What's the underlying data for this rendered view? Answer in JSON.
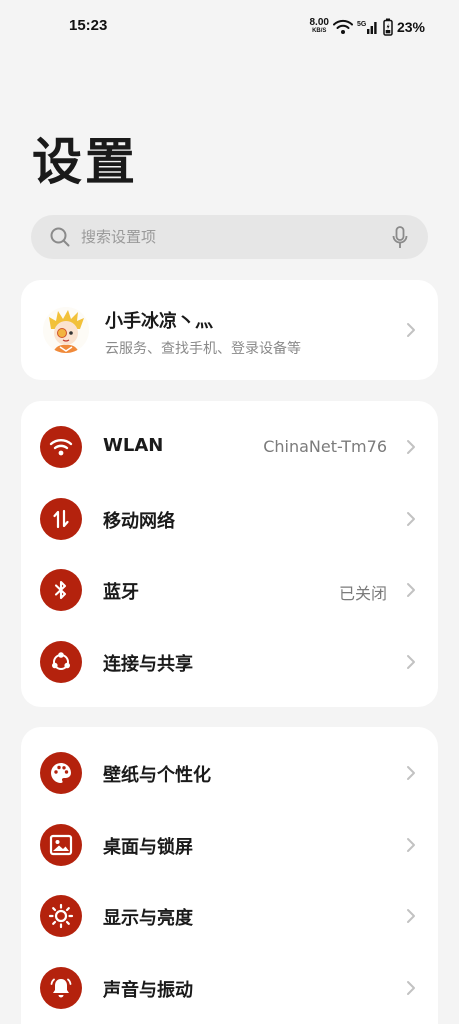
{
  "status": {
    "time": "15:23",
    "net_speed": "8.00",
    "net_speed_unit": "KB/S",
    "signal_label": "5G",
    "battery": "23%"
  },
  "page_title": "设置",
  "search": {
    "placeholder": "搜索设置项"
  },
  "account": {
    "name": "小手冰凉丶灬",
    "subtitle": "云服务、查找手机、登录设备等"
  },
  "network_group": [
    {
      "label": "WLAN",
      "value": "ChinaNet-Tm76",
      "icon": "wifi-icon"
    },
    {
      "label": "移动网络",
      "value": "",
      "icon": "mobile-data-icon"
    },
    {
      "label": "蓝牙",
      "value": "已关闭",
      "icon": "bluetooth-icon"
    },
    {
      "label": "连接与共享",
      "value": "",
      "icon": "share-icon"
    }
  ],
  "personal_group": [
    {
      "label": "壁纸与个性化",
      "icon": "palette-icon"
    },
    {
      "label": "桌面与锁屏",
      "icon": "picture-icon"
    },
    {
      "label": "显示与亮度",
      "icon": "sun-icon"
    },
    {
      "label": "声音与振动",
      "icon": "bell-icon"
    }
  ],
  "colors": {
    "accent": "#b4220d",
    "background": "#f4f4f4",
    "card": "#ffffff"
  }
}
